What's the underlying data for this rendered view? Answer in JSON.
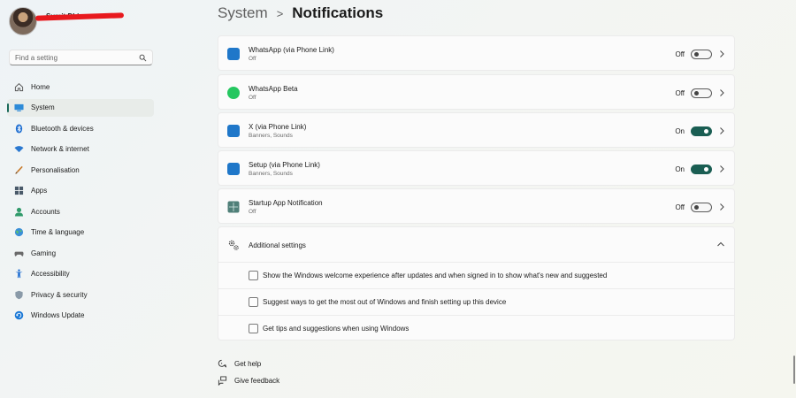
{
  "profile": {
    "name": "Sumit Dhiman"
  },
  "search": {
    "placeholder": "Find a setting"
  },
  "sidebar": {
    "items": [
      {
        "label": "Home",
        "icon": "home-icon"
      },
      {
        "label": "System",
        "icon": "system-icon",
        "active": true
      },
      {
        "label": "Bluetooth & devices",
        "icon": "bluetooth-icon"
      },
      {
        "label": "Network & internet",
        "icon": "wifi-icon"
      },
      {
        "label": "Personalisation",
        "icon": "brush-icon"
      },
      {
        "label": "Apps",
        "icon": "apps-icon"
      },
      {
        "label": "Accounts",
        "icon": "accounts-icon"
      },
      {
        "label": "Time & language",
        "icon": "globe-icon"
      },
      {
        "label": "Gaming",
        "icon": "gamepad-icon"
      },
      {
        "label": "Accessibility",
        "icon": "accessibility-icon"
      },
      {
        "label": "Privacy & security",
        "icon": "shield-icon"
      },
      {
        "label": "Windows Update",
        "icon": "update-icon"
      }
    ]
  },
  "breadcrumb": {
    "parent": "System",
    "separator": ">",
    "current": "Notifications"
  },
  "apps": [
    {
      "name": "WhatsApp (via Phone Link)",
      "sub": "Off",
      "state": "Off",
      "on": false,
      "icon": "phone-link-icon"
    },
    {
      "name": "WhatsApp Beta",
      "sub": "Off",
      "state": "Off",
      "on": false,
      "icon": "whatsapp-icon"
    },
    {
      "name": "X (via Phone Link)",
      "sub": "Banners, Sounds",
      "state": "On",
      "on": true,
      "icon": "phone-link-icon"
    },
    {
      "name": "Setup (via Phone Link)",
      "sub": "Banners, Sounds",
      "state": "On",
      "on": true,
      "icon": "phone-link-icon"
    },
    {
      "name": "Startup App Notification",
      "sub": "Off",
      "state": "Off",
      "on": false,
      "icon": "startup-app-icon"
    }
  ],
  "additional": {
    "title": "Additional settings",
    "options": [
      "Show the Windows welcome experience after updates and when signed in to show what's new and suggested",
      "Suggest ways to get the most out of Windows and finish setting up this device",
      "Get tips and suggestions when using Windows"
    ]
  },
  "footer": {
    "help": "Get help",
    "feedback": "Give feedback"
  },
  "colors": {
    "accent": "#1a5e53",
    "phone_link_blue": "#1f77c9",
    "whatsapp_green": "#25c760"
  }
}
